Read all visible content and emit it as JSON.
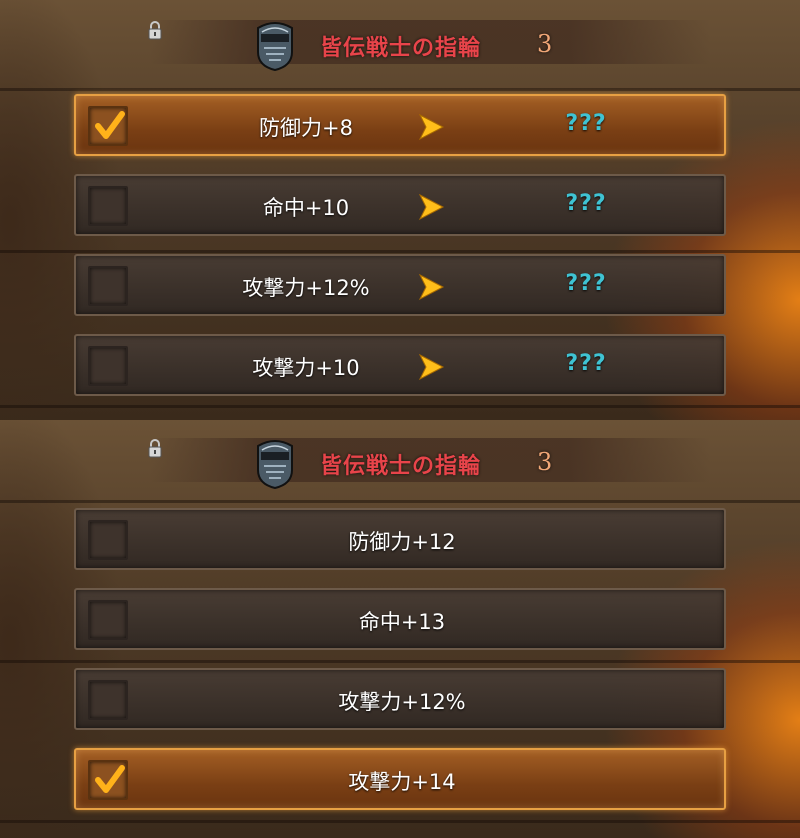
{
  "panels": [
    {
      "title": "皆伝戦士の指輪",
      "level": "3",
      "rows": [
        {
          "stat": "防御力+8",
          "result": "???",
          "selected": true
        },
        {
          "stat": "命中+10",
          "result": "???",
          "selected": false
        },
        {
          "stat": "攻撃力+12%",
          "result": "???",
          "selected": false
        },
        {
          "stat": "攻撃力+10",
          "result": "???",
          "selected": false
        }
      ]
    },
    {
      "title": "皆伝戦士の指輪",
      "level": "3",
      "rows": [
        {
          "stat": "防御力+12",
          "selected": false
        },
        {
          "stat": "命中+13",
          "selected": false
        },
        {
          "stat": "攻撃力+12%",
          "selected": false
        },
        {
          "stat": "攻撃力+14",
          "selected": true
        }
      ]
    }
  ],
  "colors": {
    "title": "#e8444a",
    "level": "#f1a777",
    "unknown": "#3fc3d3",
    "selected_border": "#e7a043",
    "check": "#ffb21a"
  },
  "icons": {
    "lock": "lock-icon",
    "item": "mask-icon",
    "arrow": "arrow-right-icon",
    "check": "checkmark-icon"
  }
}
